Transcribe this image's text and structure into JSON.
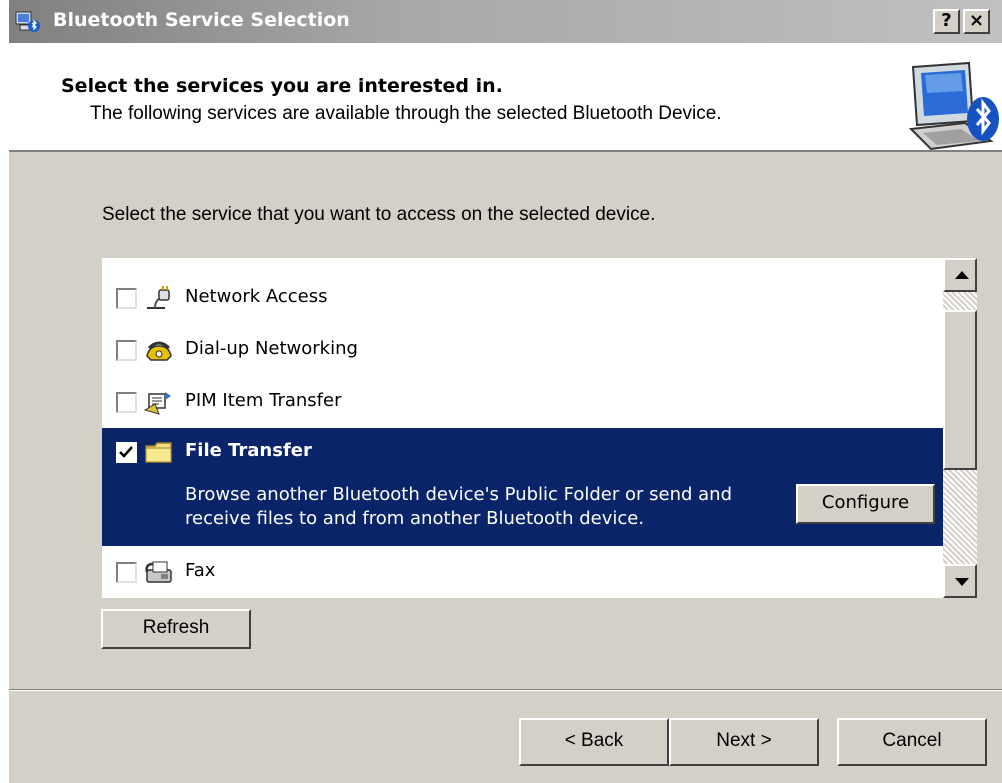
{
  "window": {
    "title": "Bluetooth Service Selection",
    "help_label": "?",
    "close_label": "×"
  },
  "header": {
    "title": "Select the services you are interested in.",
    "subtitle": "The following services are available through the selected Bluetooth Device."
  },
  "instruction": "Select the service that you want to access on the selected device.",
  "services": [
    {
      "label": "Network Access",
      "checked": false,
      "icon": "network-plug-icon"
    },
    {
      "label": "Dial-up Networking",
      "checked": false,
      "icon": "phone-icon"
    },
    {
      "label": "PIM Item Transfer",
      "checked": false,
      "icon": "pim-transfer-icon"
    },
    {
      "label": "File Transfer",
      "checked": true,
      "icon": "folder-icon",
      "description": "Browse another Bluetooth device's Public Folder or send and receive files to and from another Bluetooth device.",
      "configure_label": "Configure"
    },
    {
      "label": "Fax",
      "checked": false,
      "icon": "fax-icon"
    }
  ],
  "buttons": {
    "refresh": "Refresh",
    "back": "< Back",
    "next": "Next >",
    "cancel": "Cancel"
  },
  "colors": {
    "selection": "#0a246a",
    "face": "#d4d0c8"
  }
}
